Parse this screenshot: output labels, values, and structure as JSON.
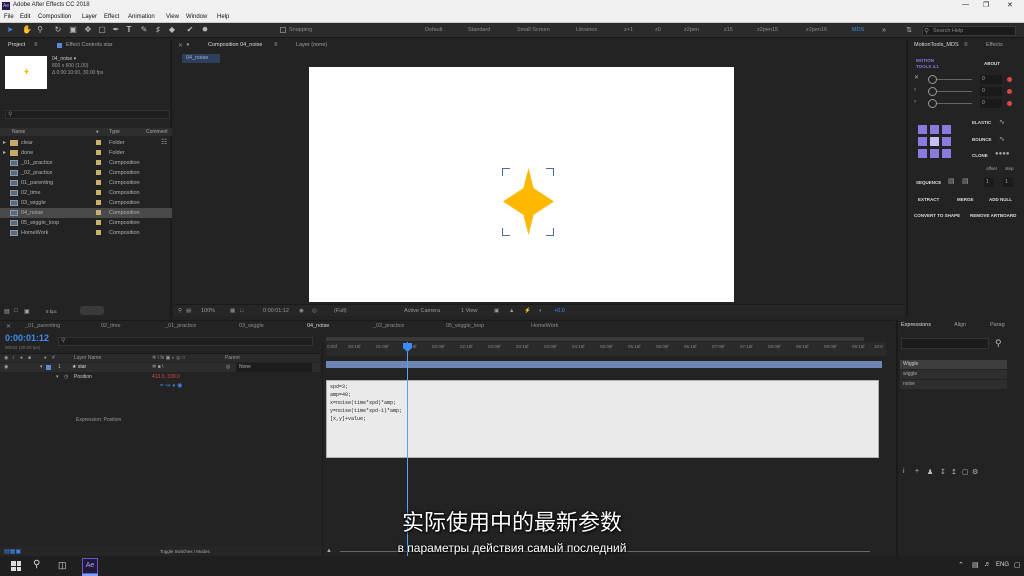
{
  "window": {
    "title": "Adobe After Effects CC 2018",
    "app_icon": "Ae"
  },
  "menu": [
    "File",
    "Edit",
    "Composition",
    "Layer",
    "Effect",
    "Animation",
    "View",
    "Window",
    "Help"
  ],
  "toolbar": {
    "snapping": "Snapping",
    "workspaces": [
      "Default",
      "Standard",
      "Small Screen",
      "Libraries",
      "z+1",
      "z0",
      "z2pen",
      "z15",
      "z2pen15",
      "z2pen16",
      "MDS"
    ],
    "search_placeholder": "Search Help"
  },
  "project": {
    "tab_label": "Project",
    "effect_controls_label": "Effect Controls star",
    "comp_name": "04_noise ▾",
    "comp_size": "800 x 600 (1.00)",
    "comp_duration": "Δ 0:00:10:00, 30.00 fps",
    "col_name": "Name",
    "col_type": "Type",
    "col_comment": "Comment",
    "items": [
      {
        "name": "clear",
        "type": "Folder",
        "kind": "folder"
      },
      {
        "name": "done",
        "type": "Folder",
        "kind": "folder"
      },
      {
        "name": "_01_practice",
        "type": "Composition",
        "kind": "comp"
      },
      {
        "name": "_02_practice",
        "type": "Composition",
        "kind": "comp"
      },
      {
        "name": "01_parenting",
        "type": "Composition",
        "kind": "comp"
      },
      {
        "name": "02_time",
        "type": "Composition",
        "kind": "comp"
      },
      {
        "name": "03_wiggle",
        "type": "Composition",
        "kind": "comp"
      },
      {
        "name": "04_noise",
        "type": "Composition",
        "kind": "comp",
        "selected": true
      },
      {
        "name": "05_wiggle_loop",
        "type": "Composition",
        "kind": "comp"
      },
      {
        "name": "HomeWork",
        "type": "Composition",
        "kind": "comp"
      }
    ],
    "bpc": "8 bpc"
  },
  "viewer": {
    "tab_label": "Composition 04_noise",
    "layer_label": "Layer (none)",
    "subtab": "04_noise",
    "zoom": "100%",
    "timecode": "0:00:01:12",
    "resolution": "(Full)",
    "camera": "Active Camera",
    "views": "1 View",
    "offset": "+0.0"
  },
  "motion_tools": {
    "tab_label": "MotionTools_MDS",
    "effects_label": "Effects",
    "brand": "MOTION TOOLS 4.1",
    "about": "ABOUT",
    "values": [
      "0",
      "0",
      "0"
    ],
    "elastic": "ELASTIC",
    "bounce": "BOUNCE",
    "clone": "CLONE",
    "offset": "offset",
    "step": "step",
    "sequence": "SEQUENCE",
    "seq_values": [
      "1",
      "1"
    ],
    "extract": "EXTRACT",
    "merge": "MERGE",
    "add_null": "ADD NULL",
    "convert": "CONVERT TO SHAPE",
    "remove_artboard": "REMOVE ARTBOARD"
  },
  "timeline": {
    "tabs": [
      "_01_parenting",
      "02_time",
      "_01_practice",
      "03_wiggle",
      "04_noise",
      "_02_practice",
      "05_wiggle_loop",
      "HomeWork"
    ],
    "active_tab": "04_noise",
    "timecode": "0:00:01:12",
    "frames": "00042 (30.00 fps)",
    "col_layer": "Layer Name",
    "col_parent": "Parent",
    "layer_num": "1",
    "layer_name": "★ star",
    "parent_value": "None",
    "property": "Position",
    "property_value": "413.0, 339.0",
    "expr_label": "Expression: Position",
    "ruler": [
      "0:00f",
      "00:15f",
      "01:00f",
      "01:15f",
      "02:00f",
      "02:15f",
      "03:00f",
      "03:15f",
      "04:00f",
      "04:15f",
      "05:00f",
      "05:15f",
      "06:00f",
      "06:15f",
      "07:00f",
      "07:15f",
      "08:00f",
      "08:15f",
      "09:00f",
      "09:15f",
      "10:0"
    ],
    "expression_lines": [
      "spd=3;",
      "amp=40;",
      "x=noise(time*spd)*amp;",
      "y=noise(time*spd-1)*amp;",
      "[x,y]+value;"
    ],
    "toggle_label": "Toggle Switches / Modes"
  },
  "expressions_panel": {
    "tabs": [
      "Expressions",
      "Align",
      "Parag"
    ],
    "items": [
      "Wiggle",
      "wiggle",
      "noise"
    ]
  },
  "subtitles": {
    "cn": "实际使用中的最新参数",
    "ru": "в параметры действия самый последний"
  },
  "taskbar": {
    "lang": "ENG",
    "app": "Ae"
  },
  "colors": {
    "accent": "#3d8bf2",
    "star": "#ffb800",
    "layer_bar": "#6f85b5"
  }
}
